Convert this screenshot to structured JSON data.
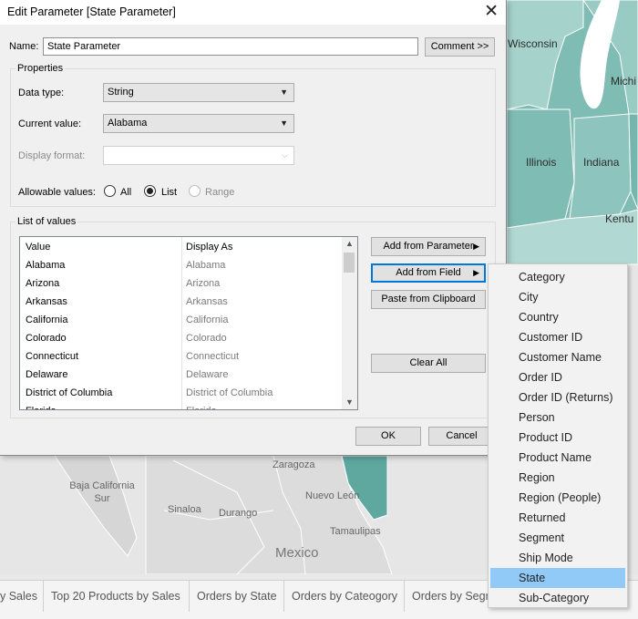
{
  "map": {
    "labels": {
      "wisconsin": "Wisconsin",
      "michigan": "Michi",
      "illinois": "Illinois",
      "indiana": "Indiana",
      "kentucky": "Kentu",
      "zaragoza": "Zaragoza",
      "baja_california_sur": "Baja California Sur",
      "sinaloa": "Sinaloa",
      "durango": "Durango",
      "nuevo_leon": "Nuevo León",
      "tamaulipas": "Tamaulipas",
      "mexico": "Mexico"
    },
    "colors": {
      "us_fill": "#7fbcb4",
      "land": "#e6e6e6",
      "lake": "#ffffff",
      "border": "#ffffff"
    }
  },
  "tabs": [
    "y Sales",
    "Top 20 Products by Sales",
    "Orders by State",
    "Orders by Cateogory",
    "Orders by Segm"
  ],
  "dialog": {
    "title": "Edit Parameter [State Parameter]",
    "name_label": "Name:",
    "name_value": "State Parameter",
    "comment_button": "Comment >>",
    "properties_label": "Properties",
    "data_type_label": "Data type:",
    "data_type_value": "String",
    "current_value_label": "Current value:",
    "current_value_value": "Alabama",
    "display_format_label": "Display format:",
    "display_format_value": "",
    "allowable_label": "Allowable values:",
    "allowable_options": [
      "All",
      "List",
      "Range"
    ],
    "allowable_selected": "List",
    "list_of_values_label": "List of values",
    "columns": {
      "value": "Value",
      "display": "Display As"
    },
    "rows": [
      {
        "value": "Alabama",
        "display": "Alabama"
      },
      {
        "value": "Arizona",
        "display": "Arizona"
      },
      {
        "value": "Arkansas",
        "display": "Arkansas"
      },
      {
        "value": "California",
        "display": "California"
      },
      {
        "value": "Colorado",
        "display": "Colorado"
      },
      {
        "value": "Connecticut",
        "display": "Connecticut"
      },
      {
        "value": "Delaware",
        "display": "Delaware"
      },
      {
        "value": "District of Columbia",
        "display": "District of Columbia"
      },
      {
        "value": "Florida",
        "display": "Florida"
      }
    ],
    "add_from_parameter": "Add from Parameter",
    "add_from_field": "Add from Field",
    "paste_from_clipboard": "Paste from Clipboard",
    "clear_all": "Clear All",
    "ok": "OK",
    "cancel": "Cancel"
  },
  "field_menu": {
    "items": [
      "Category",
      "City",
      "Country",
      "Customer ID",
      "Customer Name",
      "Order ID",
      "Order ID (Returns)",
      "Person",
      "Product ID",
      "Product Name",
      "Region",
      "Region (People)",
      "Returned",
      "Segment",
      "Ship Mode",
      "State",
      "Sub-Category"
    ],
    "selected": "State",
    "highlight_color": "#91c9f7"
  }
}
